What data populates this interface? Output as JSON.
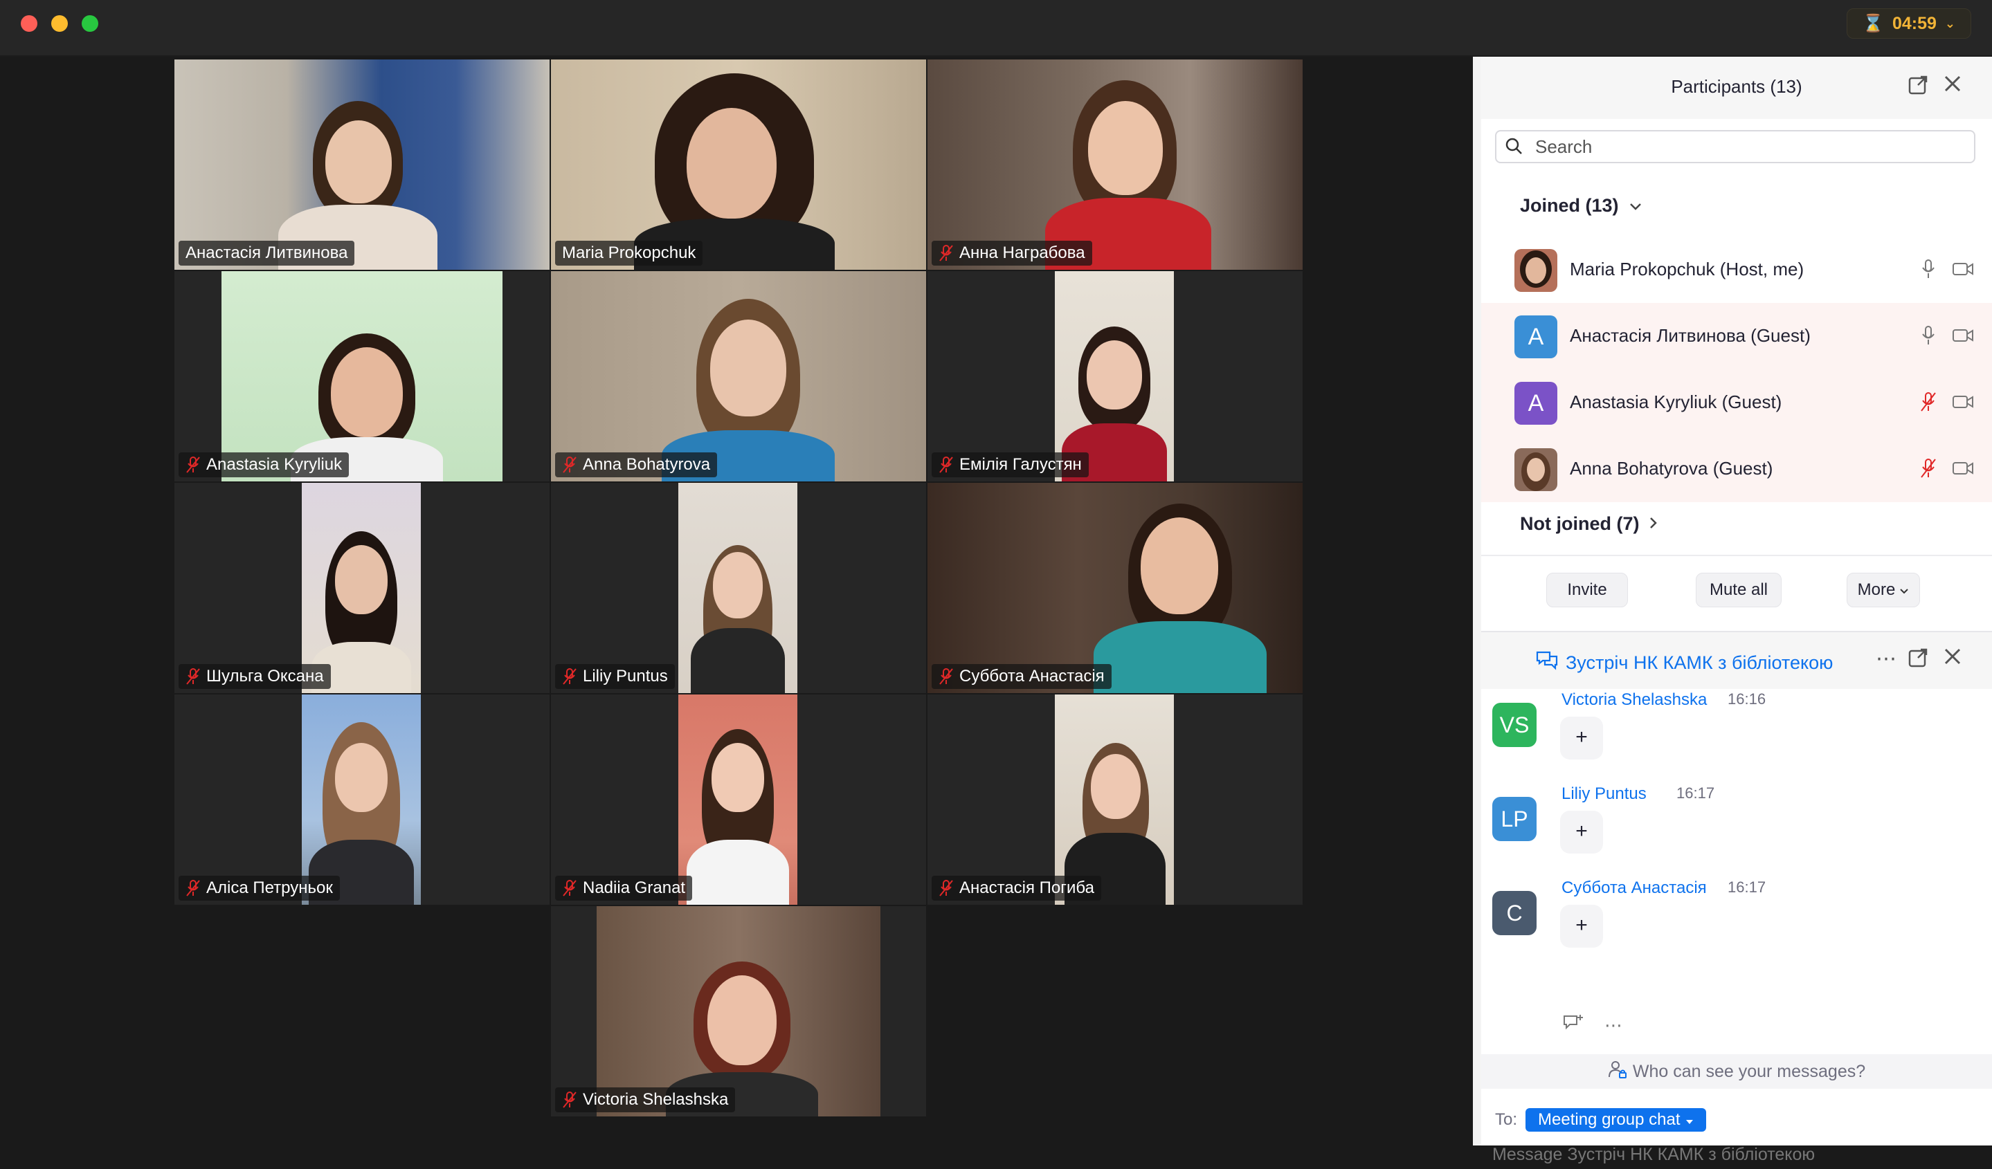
{
  "window": {
    "timer": "04:59"
  },
  "gallery": [
    {
      "name": "Анастасія Литвинова",
      "muted": false,
      "speaking": false
    },
    {
      "name": "Maria Prokopchuk",
      "muted": false,
      "speaking": true
    },
    {
      "name": "Анна Награбова",
      "muted": true,
      "speaking": false
    },
    {
      "name": "Anastasia Kyryliuk",
      "muted": true,
      "speaking": false
    },
    {
      "name": "Anna Bohatyrova",
      "muted": true,
      "speaking": false
    },
    {
      "name": "Емілія Галустян",
      "muted": true,
      "speaking": false
    },
    {
      "name": "Шульга Оксана",
      "muted": true,
      "speaking": false
    },
    {
      "name": "Liliy Puntus",
      "muted": true,
      "speaking": false
    },
    {
      "name": "Суббота Анастасія",
      "muted": true,
      "speaking": false
    },
    {
      "name": "Аліса Петруньок",
      "muted": true,
      "speaking": false
    },
    {
      "name": "Nadiia Granat",
      "muted": true,
      "speaking": false
    },
    {
      "name": "Анастасія Погиба",
      "muted": true,
      "speaking": false
    },
    {
      "name": "Victoria Shelashska",
      "muted": true,
      "speaking": false
    }
  ],
  "participants": {
    "title": "Participants (13)",
    "search_placeholder": "Search",
    "joined_label": "Joined (13)",
    "not_joined_label": "Not joined (7)",
    "list": [
      {
        "name": "Maria Prokopchuk (Host, me)",
        "initial": "",
        "avatar_color": "#b5705a",
        "mic": "on",
        "highlighted": false
      },
      {
        "name": "Анастасія Литвинова (Guest)",
        "initial": "A",
        "avatar_color": "#3a8fd6",
        "mic": "on",
        "highlighted": true
      },
      {
        "name": "Anastasia Kyryliuk (Guest)",
        "initial": "A",
        "avatar_color": "#7b52c7",
        "mic": "muted",
        "highlighted": true
      },
      {
        "name": "Anna Bohatyrova (Guest)",
        "initial": "",
        "avatar_color": "#8a6a5a",
        "mic": "muted",
        "highlighted": true
      }
    ],
    "buttons": {
      "invite": "Invite",
      "mute_all": "Mute all",
      "more": "More"
    }
  },
  "chat": {
    "title": "Зустріч НК КАМК з бібліотекою",
    "messages": [
      {
        "initials": "VS",
        "avatar_color": "#2db55d",
        "name": "Victoria Shelashska",
        "time": "16:16",
        "body": "+"
      },
      {
        "initials": "LP",
        "avatar_color": "#3a8fd6",
        "name": "Liliy Puntus",
        "time": "16:17",
        "body": "+"
      },
      {
        "initials": "С",
        "avatar_color": "#4a5a6e",
        "name": "Суббота Анастасія",
        "time": "16:17",
        "body": "+"
      }
    ],
    "who_can_see": "Who can see your messages?",
    "to_label": "To:",
    "to_target": "Meeting group chat",
    "input_placeholder": "Message Зустріч НК КАМК з бібліотекою"
  },
  "colors": {
    "accent": "#0e72ed",
    "speaking_border": "#34d058",
    "muted_icon": "#e02828",
    "timer": "#f2b437"
  }
}
